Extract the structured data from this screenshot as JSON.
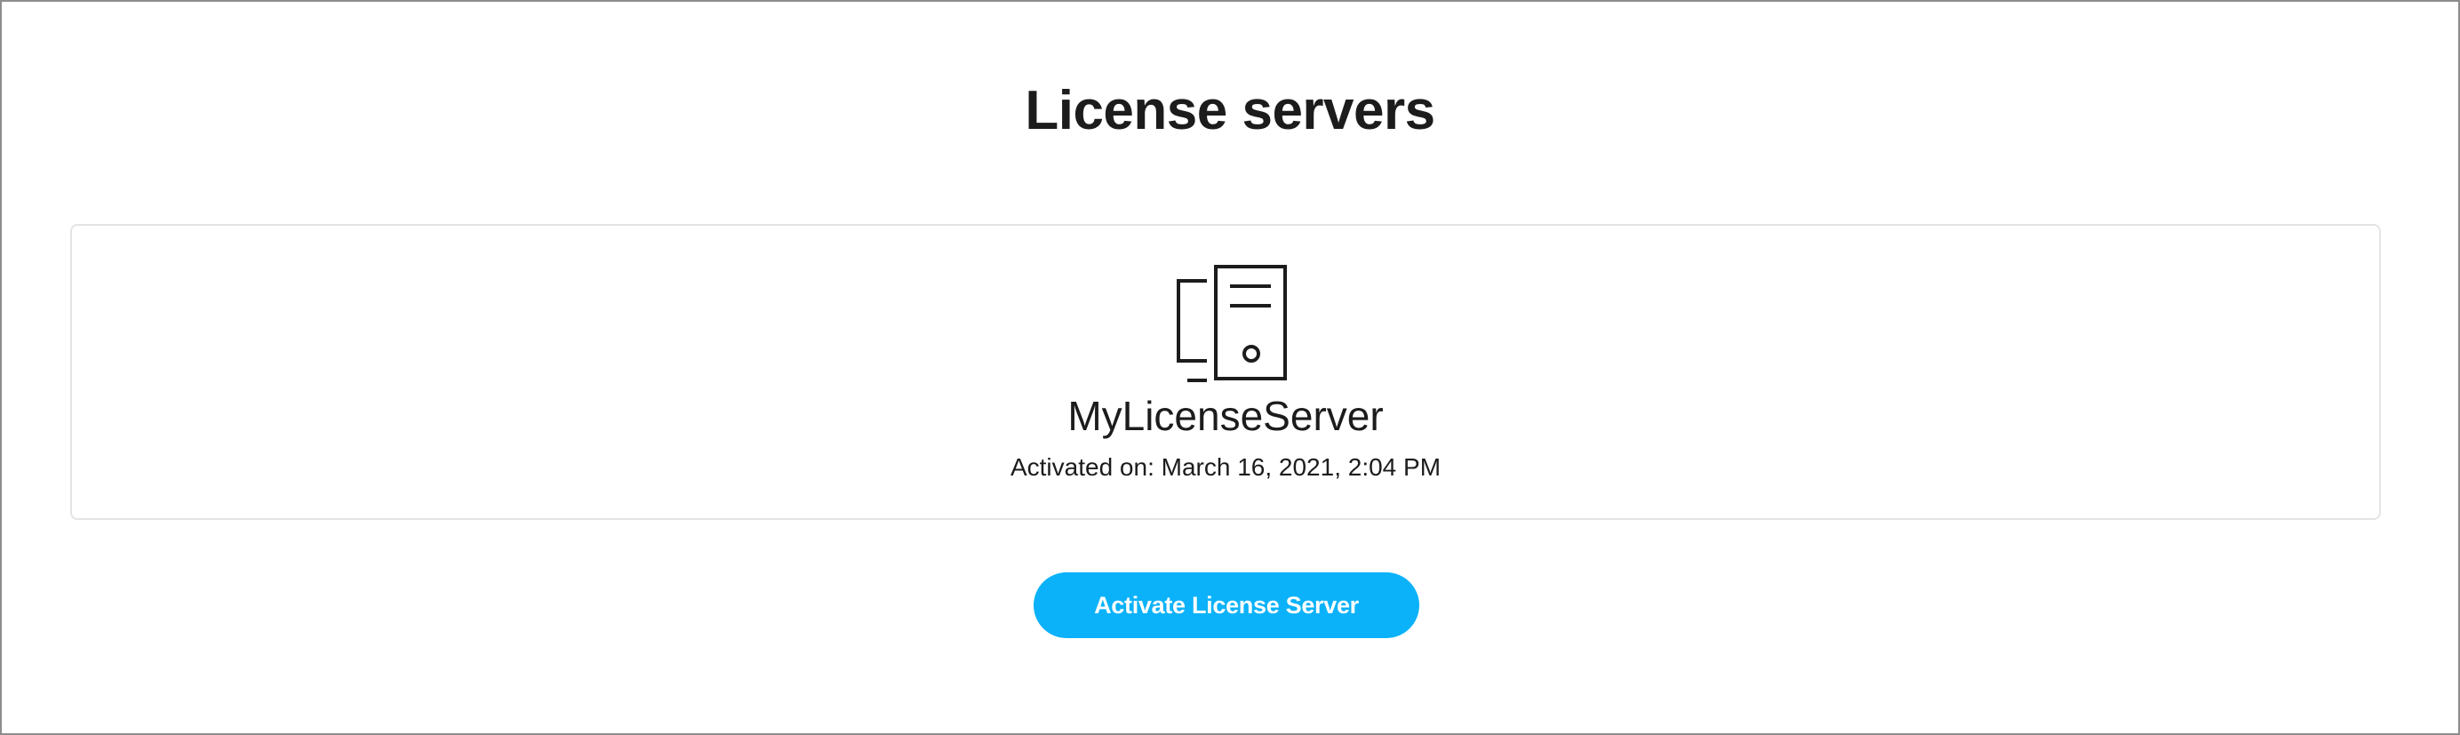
{
  "page": {
    "title": "License servers"
  },
  "server": {
    "name": "MyLicenseServer",
    "activated": "Activated on: March 16, 2021, 2:04 PM",
    "icon": "server-icon"
  },
  "actions": {
    "activate_label": "Activate License Server"
  },
  "colors": {
    "accent": "#0bb2f9",
    "text": "#1c1c1c",
    "card_border": "#e4e4e4",
    "frame_border": "#8d8d8d"
  }
}
